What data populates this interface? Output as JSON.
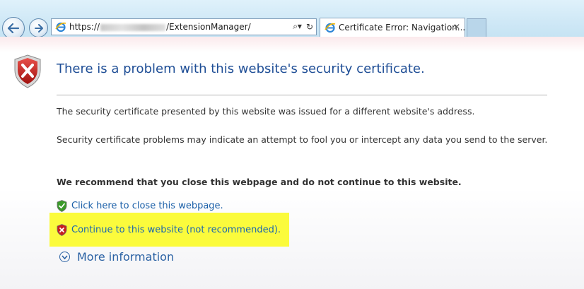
{
  "browser": {
    "address": {
      "prefix": "https://",
      "suffix": "/ExtensionManager/",
      "search_glyph": "⌕▾",
      "refresh_glyph": "↻"
    },
    "tab": {
      "title": "Certificate Error: Navigation...",
      "close_glyph": "✕"
    }
  },
  "page": {
    "title": "There is a problem with this website's security certificate.",
    "paragraph1": "The security certificate presented by this website was issued for a different website's address.",
    "paragraph2": "Security certificate problems may indicate an attempt to fool you or intercept any data you send to the server.",
    "recommendation": "We recommend that you close this webpage and do not continue to this website.",
    "close_link": "Click here to close this webpage.",
    "continue_link": "Continue to this website (not recommended).",
    "more_info": "More information"
  },
  "icons": {
    "back": "back-arrow-icon",
    "forward": "forward-arrow-icon",
    "site": "ie-page-icon",
    "warning": "red-shield-x-icon",
    "safe": "green-shield-check-icon",
    "unsafe": "red-shield-x-small-icon",
    "expand": "chevron-down-circle-icon"
  },
  "colors": {
    "title": "#1f4e96",
    "link": "#1a5fa8",
    "highlight": "#fbfb3c",
    "shield_red": "#c8201e",
    "shield_green": "#3a9a2a"
  }
}
